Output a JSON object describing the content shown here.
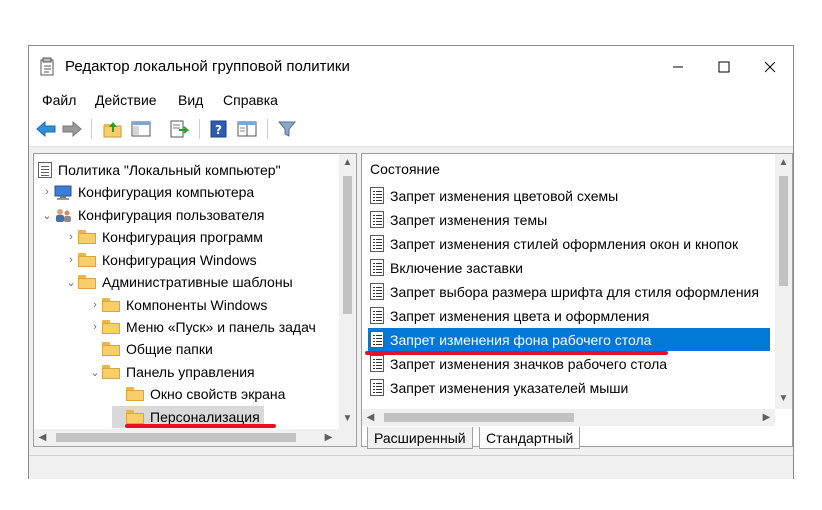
{
  "window": {
    "title": "Редактор локальной групповой политики"
  },
  "menu": [
    "Файл",
    "Действие",
    "Вид",
    "Справка"
  ],
  "toolbar": {
    "buttons": [
      "back-icon",
      "forward-icon",
      "up-folder-icon",
      "show-hide-tree-icon",
      "export-list-icon",
      "help-icon",
      "properties-pane-icon",
      "filter-icon"
    ]
  },
  "tree": {
    "root": "Политика \"Локальный компьютер\"",
    "items": [
      {
        "label": "Конфигурация компьютера",
        "expanded": false
      },
      {
        "label": "Конфигурация пользователя",
        "expanded": true
      },
      {
        "label": "Конфигурация программ",
        "expanded": false
      },
      {
        "label": "Конфигурация Windows",
        "expanded": false
      },
      {
        "label": "Административные шаблоны",
        "expanded": true
      },
      {
        "label": "Компоненты Windows",
        "expanded": false
      },
      {
        "label": "Меню «Пуск» и панель задач",
        "expanded": false
      },
      {
        "label": "Общие папки",
        "expanded": false
      },
      {
        "label": "Панель управления",
        "expanded": true
      },
      {
        "label": "Окно свойств экрана",
        "expanded": false
      },
      {
        "label": "Персонализация",
        "selected": true
      }
    ]
  },
  "list": {
    "header": "Состояние",
    "rows": [
      "Запрет изменения цветовой схемы",
      "Запрет изменения темы",
      "Запрет изменения стилей оформления окон и кнопок",
      "Включение заставки",
      "Запрет выбора размера шрифта для стиля оформления",
      "Запрет изменения цвета и оформления",
      "Запрет изменения фона рабочего стола",
      "Запрет изменения значков рабочего стола",
      "Запрет изменения указателей мыши"
    ],
    "selected_index": 6
  },
  "tabs": [
    "Расширенный",
    "Стандартный"
  ],
  "colors": {
    "selection": "#0078d7",
    "annotation_red": "#e81123",
    "folder": "#f6cf6a"
  }
}
